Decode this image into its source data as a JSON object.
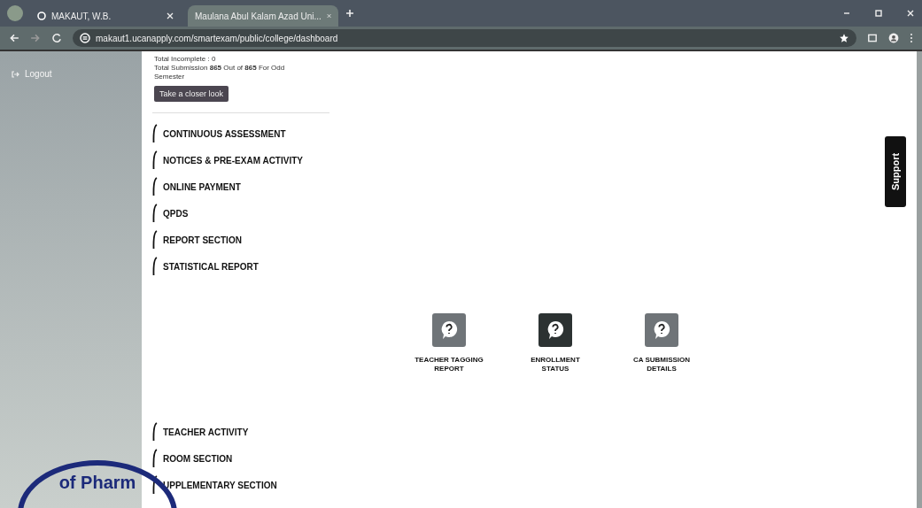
{
  "browser": {
    "tabs": [
      {
        "label": "MAKAUT, W.B.",
        "selected": false
      },
      {
        "label": "Maulana Abul Kalam Azad Uni...",
        "selected": true
      }
    ],
    "address": "makaut1.ucanapply.com/smartexam/public/college/dashboard"
  },
  "sidebar": {
    "items": [
      {
        "label": "Logout"
      }
    ]
  },
  "summary": {
    "lines": [
      "Total Incomplete : 0",
      "Total Submission **865** Out of **865** For Odd",
      "Semester"
    ],
    "button": "Take a closer look"
  },
  "sections_top": [
    "CONTINUOUS ASSESSMENT",
    "NOTICES & PRE-EXAM ACTIVITY",
    "ONLINE PAYMENT",
    "QPDS",
    "REPORT SECTION",
    "STATISTICAL REPORT"
  ],
  "report_cards": [
    {
      "label": "TEACHER TAGGING REPORT",
      "selected": false
    },
    {
      "label": "ENROLLMENT STATUS",
      "selected": true
    },
    {
      "label": "CA SUBMISSION DETAILS",
      "selected": false
    }
  ],
  "sections_bottom": [
    "TEACHER ACTIVITY",
    "ROOM SECTION",
    "UPPLEMENTARY SECTION"
  ],
  "support_tab": "Support",
  "stamp": {
    "text": "of Pharm"
  }
}
